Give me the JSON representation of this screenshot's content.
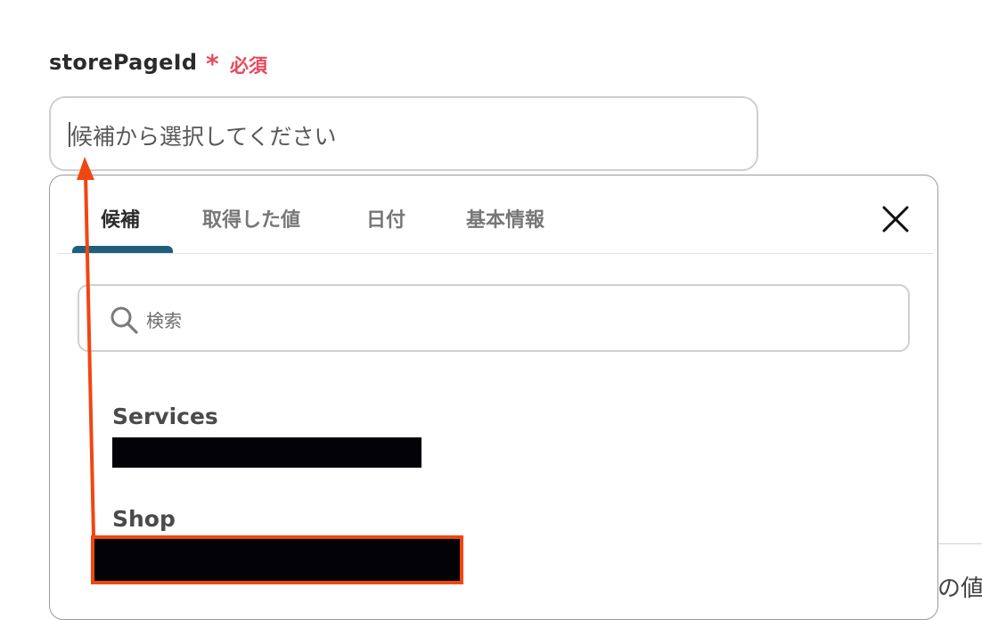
{
  "field": {
    "label": "storePageId",
    "required_mark": "*",
    "required_text": "必須",
    "placeholder": "候補から選択してください"
  },
  "background": {
    "partial_text": "の値"
  },
  "tabs": [
    {
      "label": "候補",
      "active": true
    },
    {
      "label": "取得した値",
      "active": false
    },
    {
      "label": "日付",
      "active": false
    },
    {
      "label": "基本情報",
      "active": false
    }
  ],
  "search": {
    "placeholder": "検索"
  },
  "options": [
    {
      "label": "Services"
    },
    {
      "label": "Shop"
    }
  ],
  "colors": {
    "required": "#e8495c",
    "tab_indicator": "#1f5f7c",
    "annotation": "#f24611"
  }
}
